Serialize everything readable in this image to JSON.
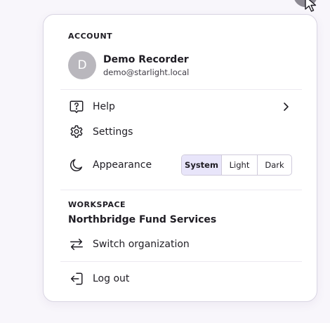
{
  "account": {
    "section_label": "ACCOUNT",
    "avatar_initial": "D",
    "name": "Demo Recorder",
    "email": "demo@starlight.local"
  },
  "menu": {
    "help_label": "Help",
    "settings_label": "Settings",
    "appearance_label": "Appearance",
    "appearance_options": [
      "System",
      "Light",
      "Dark"
    ],
    "appearance_selected": "System"
  },
  "workspace": {
    "section_label": "WORKSPACE",
    "org_name": "Northbridge Fund Services",
    "switch_label": "Switch organization"
  },
  "logout_label": "Log out",
  "colors": {
    "accent_selected_bg": "#e8e5fa",
    "avatar_bg": "#b9b7bd"
  }
}
